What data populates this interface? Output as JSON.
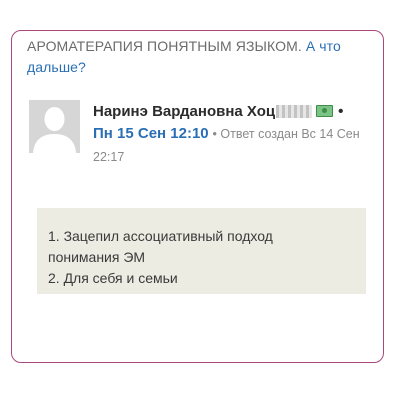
{
  "question": {
    "title": "АРОМАТЕРАПИЯ ПОНЯТНЫМ ЯЗЫКОМ.",
    "link": "А что дальше?"
  },
  "answer": {
    "author": "Наринэ Вардановна Хоц",
    "badge_icon": "money-icon",
    "separator": "•",
    "date": "Пн 15 Сен 12:10",
    "created_label": "• Ответ создан Вс 14 Сен 22:17",
    "lines": [
      "1. Зацепил ассоциативный подход",
      "понимания ЭМ",
      "2. Для себя и семьи"
    ]
  },
  "colors": {
    "card_border": "#a8487f",
    "link": "#2a6fb5",
    "answer_bg": "#ecece3"
  }
}
